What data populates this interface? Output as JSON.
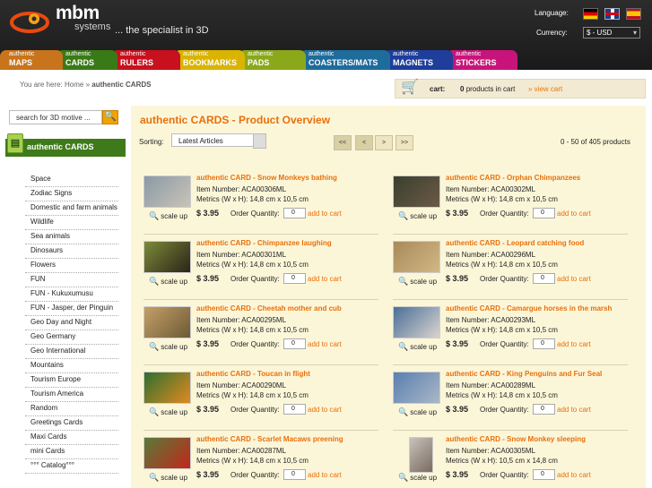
{
  "header": {
    "logo_text": "mbm",
    "logo_sub": "systems",
    "tagline": "... the specialist in 3D",
    "language_label": "Language:",
    "currency_label": "Currency:",
    "currency_value": "$ - USD",
    "flags": [
      "german-flag",
      "english-flag",
      "spanish-flag"
    ]
  },
  "nav": {
    "tabs": [
      {
        "small": "authentic",
        "big": "MAPS",
        "color": "#c8741c"
      },
      {
        "small": "authentic",
        "big": "CARDS",
        "color": "#3a7a16"
      },
      {
        "small": "authentic",
        "big": "RULERS",
        "color": "#c8101e"
      },
      {
        "small": "authentic",
        "big": "BOOKMARKS",
        "color": "#d9b400"
      },
      {
        "small": "authentic",
        "big": "PADS",
        "color": "#8aa81a"
      },
      {
        "small": "authentic",
        "big": "COASTERS/MATS",
        "color": "#1e6c9c"
      },
      {
        "small": "authentic",
        "big": "MAGNETS",
        "color": "#1f3d9a"
      },
      {
        "small": "authentic",
        "big": "STICKERS",
        "color": "#c8147a"
      }
    ]
  },
  "breadcrumb": {
    "prefix": "You are here:",
    "home": "Home",
    "sep": "»",
    "current": "authentic CARDS"
  },
  "cart": {
    "label": "cart:",
    "count": "0",
    "count_suffix": "products in cart",
    "link": "» view cart"
  },
  "search": {
    "placeholder": "search for 3D motive ..."
  },
  "sidebar": {
    "header": "authentic CARDS",
    "items": [
      "Space",
      "Zodiac Signs",
      "Domestic and farm animals",
      "Wildlife",
      "Sea animals",
      "Dinosaurs",
      "Flowers",
      "FUN",
      "FUN - Kukuxumusu",
      "FUN - Jasper, der Pinguin",
      "Geo Day and Night",
      "Geo Germany",
      "Geo International",
      "Mountains",
      "Tourism Europe",
      "Tourism America",
      "Random",
      "Greetings Cards",
      "Maxi Cards",
      "mini Cards",
      "°°° Catalog°°°"
    ]
  },
  "main": {
    "title": "authentic CARDS - Product Overview",
    "sort_label": "Sorting:",
    "sort_value": "Latest Articles",
    "pager": [
      "<<",
      "<",
      ">",
      ">>"
    ],
    "results": "0 - 50 of 405 products"
  },
  "products": [
    {
      "name": "authentic CARD - Snow Monkeys bathing",
      "item_number": "Item Number: ACA00306ML",
      "metrics": "Metrics (W x H): 14,8 cm x 10,5 cm",
      "price": "$ 3.95",
      "qty": "0"
    },
    {
      "name": "authentic CARD - Orphan Chimpanzees",
      "item_number": "Item Number: ACA00302ML",
      "metrics": "Metrics (W x H): 14,8 cm x 10,5 cm",
      "price": "$ 3.95",
      "qty": "0"
    },
    {
      "name": "authentic CARD - Chimpanzee laughing",
      "item_number": "Item Number: ACA00301ML",
      "metrics": "Metrics (W x H): 14,8 cm x 10,5 cm",
      "price": "$ 3.95",
      "qty": "0"
    },
    {
      "name": "authentic CARD - Leopard catching food",
      "item_number": "Item Number: ACA00296ML",
      "metrics": "Metrics (W x H): 14,8 cm x 10,5 cm",
      "price": "$ 3.95",
      "qty": "0"
    },
    {
      "name": "authentic CARD - Cheetah mother and cub",
      "item_number": "Item Number: ACA00295ML",
      "metrics": "Metrics (W x H): 14,8 cm x 10,5 cm",
      "price": "$ 3.95",
      "qty": "0"
    },
    {
      "name": "authentic CARD - Camargue horses in the marsh",
      "item_number": "Item Number: ACA00293ML",
      "metrics": "Metrics (W x H): 14,8 cm x 10,5 cm",
      "price": "$ 3.95",
      "qty": "0"
    },
    {
      "name": "authentic CARD - Toucan in flight",
      "item_number": "Item Number: ACA00290ML",
      "metrics": "Metrics (W x H): 14,8 cm x 10,5 cm",
      "price": "$ 3.95",
      "qty": "0"
    },
    {
      "name": "authentic CARD - King Penguins and Fur Seal",
      "item_number": "Item Number: ACA00289ML",
      "metrics": "Metrics (W x H): 14,8 cm x 10,5 cm",
      "price": "$ 3.95",
      "qty": "0"
    },
    {
      "name": "authentic CARD - Scarlet Macaws preening",
      "item_number": "Item Number: ACA00287ML",
      "metrics": "Metrics (W x H): 14,8 cm x 10,5 cm",
      "price": "$ 3.95",
      "qty": "0"
    },
    {
      "name": "authentic CARD - Snow Monkey sleeping",
      "item_number": "Item Number: ACA00305ML",
      "metrics": "Metrics (W x H): 10,5 cm x 14,8 cm",
      "price": "$ 3.95",
      "qty": "0"
    }
  ],
  "product_labels": {
    "scale": "scale up",
    "order_qty": "Order Quantity:",
    "add": "add to cart"
  }
}
